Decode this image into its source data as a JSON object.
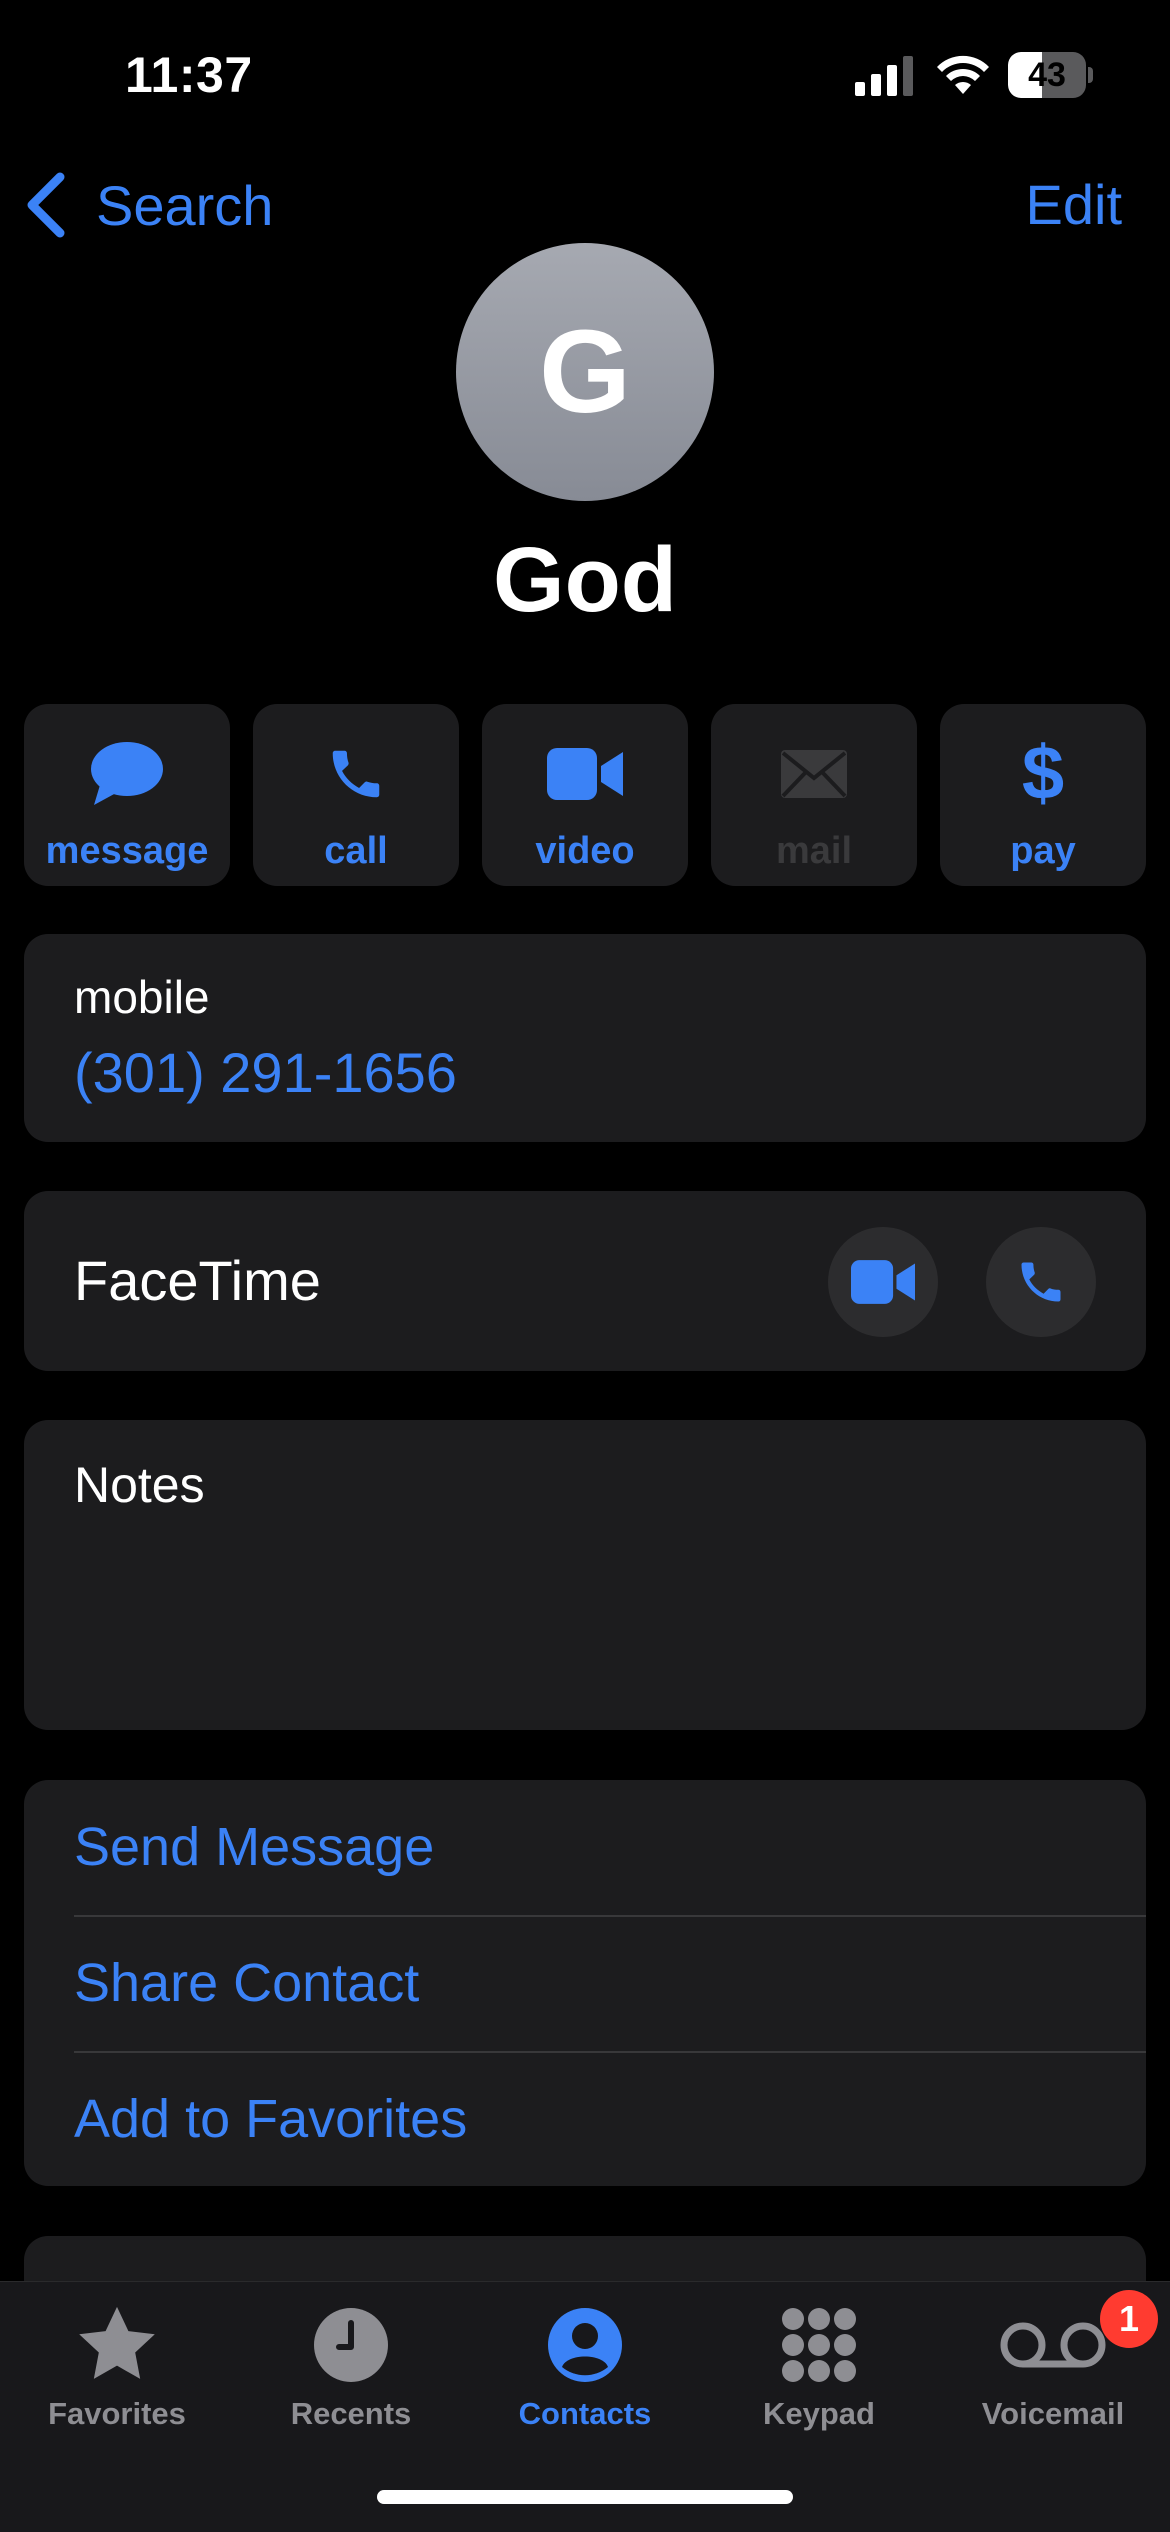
{
  "status_bar": {
    "time": "11:37",
    "battery": "43",
    "battery_level": 0.43
  },
  "nav": {
    "back_label": "Search",
    "edit_label": "Edit"
  },
  "contact": {
    "initial": "G",
    "name": "God"
  },
  "actions": [
    {
      "label": "message",
      "icon": "message-bubble-icon",
      "enabled": true
    },
    {
      "label": "call",
      "icon": "phone-icon",
      "enabled": true
    },
    {
      "label": "video",
      "icon": "video-camera-icon",
      "enabled": true
    },
    {
      "label": "mail",
      "icon": "envelope-icon",
      "enabled": false
    },
    {
      "label": "pay",
      "icon": "dollar-icon",
      "enabled": true
    }
  ],
  "phone": {
    "label": "mobile",
    "number": "(301) 291-1656"
  },
  "facetime": {
    "label": "FaceTime"
  },
  "notes": {
    "label": "Notes"
  },
  "links": [
    {
      "label": "Send Message"
    },
    {
      "label": "Share Contact"
    },
    {
      "label": "Add to Favorites"
    }
  ],
  "tabs": [
    {
      "label": "Favorites",
      "icon": "star-icon",
      "active": false
    },
    {
      "label": "Recents",
      "icon": "clock-icon",
      "active": false
    },
    {
      "label": "Contacts",
      "icon": "person-circle-icon",
      "active": true
    },
    {
      "label": "Keypad",
      "icon": "keypad-icon",
      "active": false
    },
    {
      "label": "Voicemail",
      "icon": "voicemail-icon",
      "active": false,
      "badge": "1"
    }
  ],
  "colors": {
    "accent": "#3b82f6",
    "card": "#1c1c1e",
    "badge": "#ff3b30",
    "inactive": "#8e8e93"
  }
}
